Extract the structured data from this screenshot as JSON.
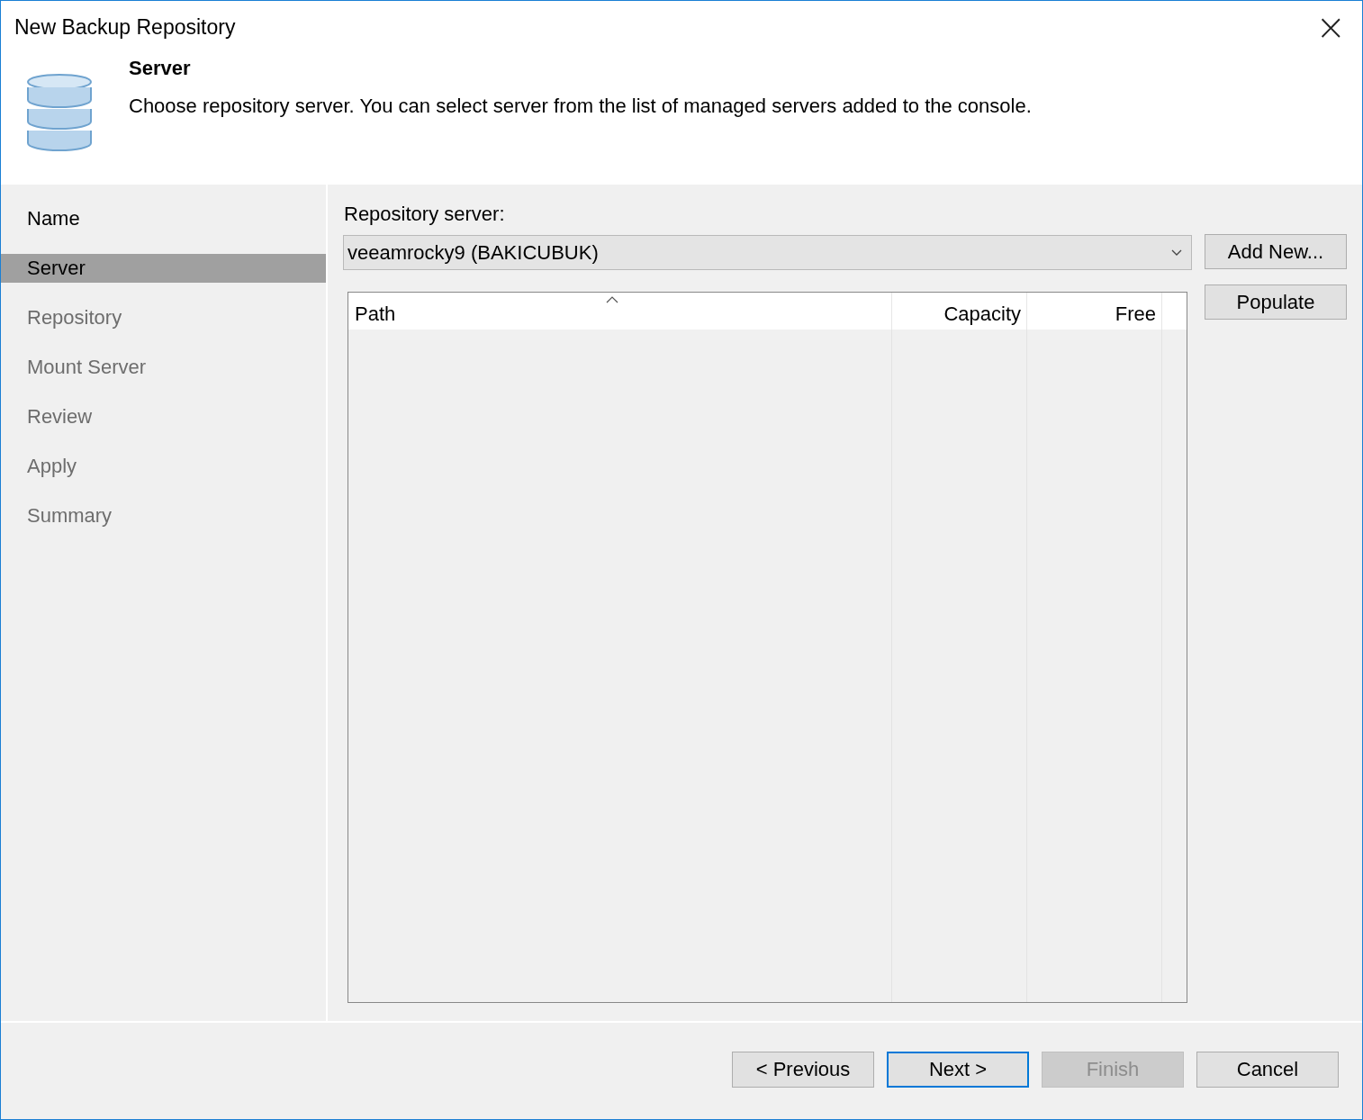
{
  "window": {
    "title": "New Backup Repository",
    "close": "×"
  },
  "header": {
    "title": "Server",
    "description": "Choose repository server. You can select server from the list of managed servers added to the console."
  },
  "steps": [
    {
      "label": "Name",
      "selected": false,
      "disabled": false
    },
    {
      "label": "Server",
      "selected": true,
      "disabled": false
    },
    {
      "label": "Repository",
      "selected": false,
      "disabled": true
    },
    {
      "label": "Mount Server",
      "selected": false,
      "disabled": true
    },
    {
      "label": "Review",
      "selected": false,
      "disabled": true
    },
    {
      "label": "Apply",
      "selected": false,
      "disabled": true
    },
    {
      "label": "Summary",
      "selected": false,
      "disabled": true
    }
  ],
  "repository_server": {
    "label": "Repository server:",
    "value": "veeamrocky9 (BAKICUBUK)"
  },
  "side_buttons": [
    "Add New...",
    "Populate"
  ],
  "table": {
    "columns": [
      {
        "label": "Path",
        "sorted": true
      },
      {
        "label": "Capacity",
        "sorted": false
      },
      {
        "label": "Free",
        "sorted": false
      }
    ]
  },
  "buttons": [
    {
      "label": "< Previous",
      "disabled": false,
      "focused": false
    },
    {
      "label": "Next >",
      "disabled": false,
      "focused": true
    },
    {
      "label": "Finish",
      "disabled": true,
      "focused": false
    },
    {
      "label": "Cancel",
      "disabled": false,
      "focused": false
    }
  ]
}
